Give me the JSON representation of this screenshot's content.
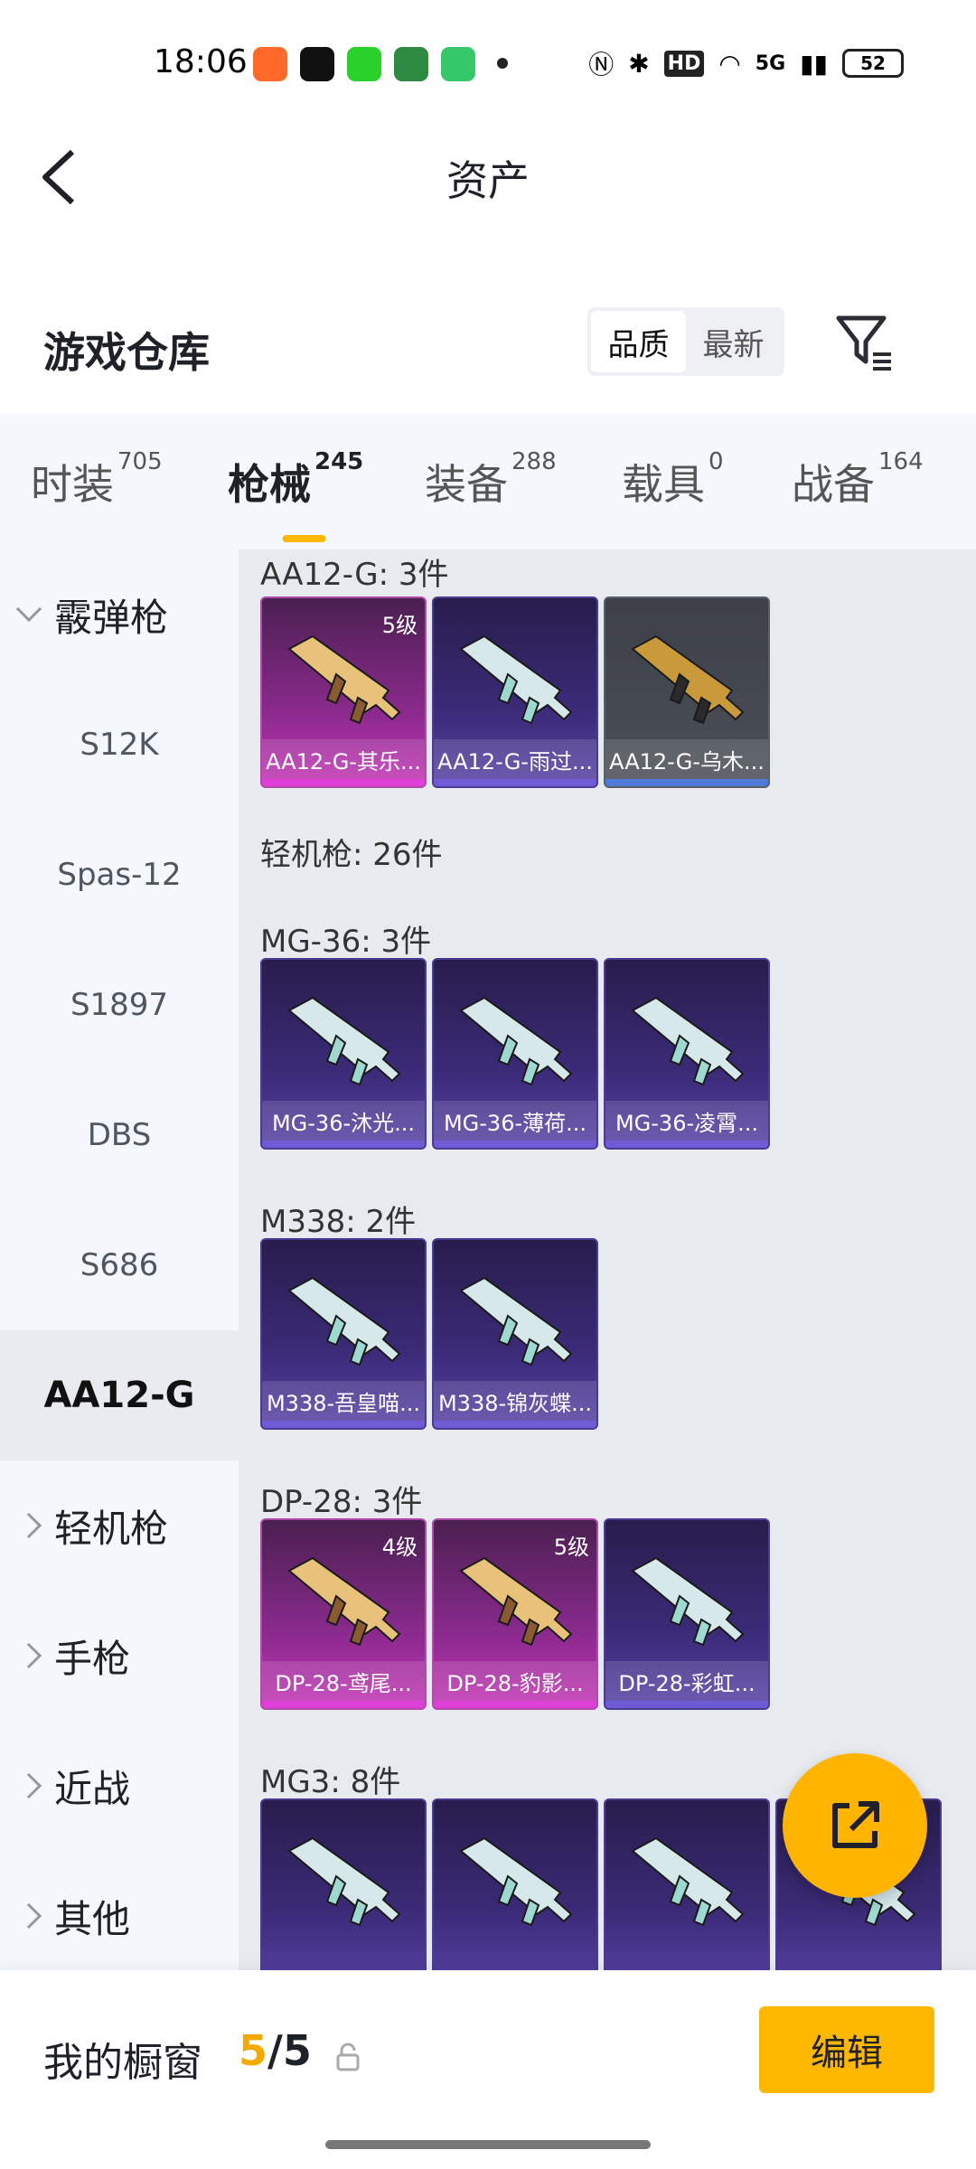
{
  "status": {
    "time": "18:06",
    "battery": "52",
    "network": "5G",
    "hd": "HD"
  },
  "header": {
    "title": "资产"
  },
  "warehouse": {
    "title": "游戏仓库",
    "sort_quality": "品质",
    "sort_newest": "最新"
  },
  "tabs": [
    {
      "label": "时装",
      "count": "705"
    },
    {
      "label": "枪械",
      "count": "245"
    },
    {
      "label": "装备",
      "count": "288"
    },
    {
      "label": "载具",
      "count": "0"
    },
    {
      "label": "战备",
      "count": "164"
    }
  ],
  "sidebar": {
    "cat_shotgun": "霰弹枪",
    "items": [
      "S12K",
      "Spas-12",
      "S1897",
      "DBS",
      "S686",
      "AA12-G"
    ],
    "cat_lmg": "轻机枪",
    "cat_pistol": "手枪",
    "cat_melee": "近战",
    "cat_other": "其他"
  },
  "content": {
    "aa12_header": "AA12-G: 3件",
    "aa12": [
      {
        "name": "AA12-G-其乐...",
        "level": "5级",
        "rarity": "pink"
      },
      {
        "name": "AA12-G-雨过...",
        "level": "",
        "rarity": "purple"
      },
      {
        "name": "AA12-G-乌木...",
        "level": "",
        "rarity": "grey"
      }
    ],
    "lmg_header": "轻机枪: 26件",
    "mg36_header": "MG-36: 3件",
    "mg36": [
      {
        "name": "MG-36-沐光...",
        "level": "",
        "rarity": "purple"
      },
      {
        "name": "MG-36-薄荷...",
        "level": "",
        "rarity": "purple"
      },
      {
        "name": "MG-36-凌霄...",
        "level": "",
        "rarity": "purple"
      }
    ],
    "m338_header": "M338: 2件",
    "m338": [
      {
        "name": "M338-吾皇喵...",
        "level": "",
        "rarity": "purple"
      },
      {
        "name": "M338-锦灰蝶...",
        "level": "",
        "rarity": "purple"
      }
    ],
    "dp28_header": "DP-28: 3件",
    "dp28": [
      {
        "name": "DP-28-鸢尾...",
        "level": "4级",
        "rarity": "pink"
      },
      {
        "name": "DP-28-豹影...",
        "level": "5级",
        "rarity": "pink"
      },
      {
        "name": "DP-28-彩虹...",
        "level": "",
        "rarity": "purple"
      }
    ],
    "mg3_header": "MG3: 8件"
  },
  "bottom": {
    "title": "我的橱窗",
    "current": "5",
    "separator": "/",
    "total": "5",
    "edit": "编辑"
  }
}
